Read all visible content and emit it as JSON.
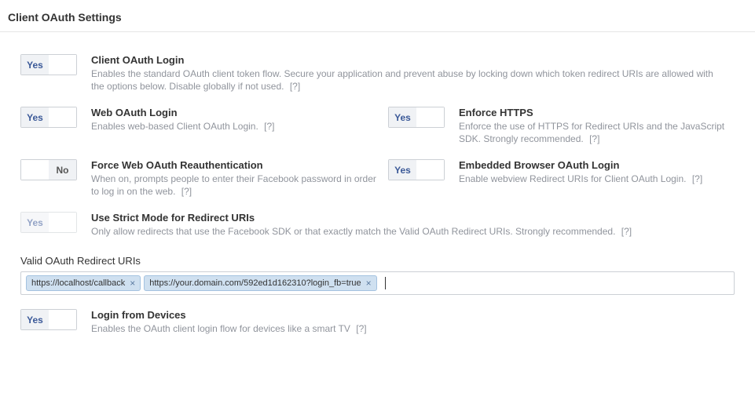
{
  "page_title": "Client OAuth Settings",
  "labels": {
    "yes": "Yes",
    "no": "No",
    "help": "[?]"
  },
  "settings": {
    "client_oauth_login": {
      "title": "Client OAuth Login",
      "desc": "Enables the standard OAuth client token flow. Secure your application and prevent abuse by locking down which token redirect URIs are allowed with the options below. Disable globally if not used.",
      "value": "Yes"
    },
    "web_oauth_login": {
      "title": "Web OAuth Login",
      "desc": "Enables web-based Client OAuth Login.",
      "value": "Yes"
    },
    "enforce_https": {
      "title": "Enforce HTTPS",
      "desc": "Enforce the use of HTTPS for Redirect URIs and the JavaScript SDK. Strongly recommended.",
      "value": "Yes"
    },
    "force_reauth": {
      "title": "Force Web OAuth Reauthentication",
      "desc": "When on, prompts people to enter their Facebook password in order to log in on the web.",
      "value": "No"
    },
    "embedded_browser": {
      "title": "Embedded Browser OAuth Login",
      "desc": "Enable webview Redirect URIs for Client OAuth Login.",
      "value": "Yes"
    },
    "strict_mode": {
      "title": "Use Strict Mode for Redirect URIs",
      "desc": "Only allow redirects that use the Facebook SDK or that exactly match the Valid OAuth Redirect URIs. Strongly recommended.",
      "value": "Yes",
      "disabled": true
    },
    "login_from_devices": {
      "title": "Login from Devices",
      "desc": "Enables the OAuth client login flow for devices like a smart TV",
      "value": "Yes"
    }
  },
  "redirect_uris": {
    "label": "Valid OAuth Redirect URIs",
    "items": [
      "https://localhost/callback",
      "https://your.domain.com/592ed1d162310?login_fb=true"
    ]
  }
}
